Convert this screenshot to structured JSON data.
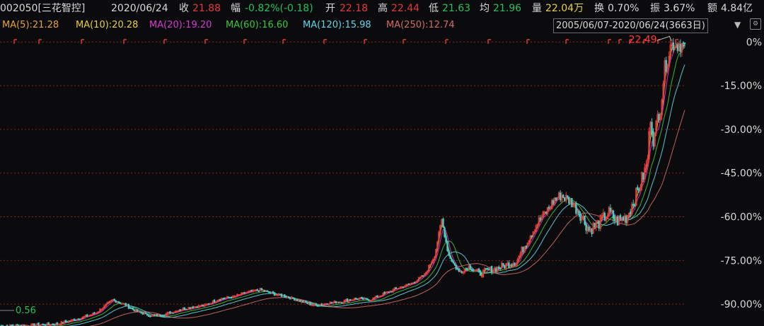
{
  "header": {
    "code_name": "002050[三花智控]",
    "date": "2020/06/24",
    "close": {
      "label": "收",
      "value": "21.88"
    },
    "change": {
      "label": "幅",
      "value": "-0.82%(-0.18)"
    },
    "open": {
      "label": "开",
      "value": "22.18"
    },
    "high": {
      "label": "高",
      "value": "22.44"
    },
    "low": {
      "label": "低",
      "value": "21.63"
    },
    "avg": {
      "label": "均",
      "value": "21.96"
    },
    "volume": {
      "label": "量",
      "value": "22.04万"
    },
    "turnover": {
      "label": "换",
      "value": "0.70%"
    },
    "amplitude": {
      "label": "振",
      "value": "3.67%"
    },
    "amount": {
      "label": "额",
      "value": "4.84亿"
    }
  },
  "ma_bar": [
    {
      "text": "MA(5):21.28",
      "color": "#e8a23a"
    },
    {
      "text": "MA(10):20.28",
      "color": "#e8d23a"
    },
    {
      "text": "MA(20):19.20",
      "color": "#d63ad6"
    },
    {
      "text": "MA(60):16.60",
      "color": "#3ac83a"
    },
    {
      "text": "MA(120):15.98",
      "color": "#5ed8e8"
    },
    {
      "text": "MA(250):12.74",
      "color": "#d06a6a"
    }
  ],
  "range_label": "2005/06/07-2020/06/24(3663日)",
  "colors": {
    "up": "#e23a3a",
    "down": "#3ad0c8",
    "grid": "#8a2020",
    "axis_text": "#d8d8d8",
    "low_label": "#22c45a",
    "high_label": "#ff3a3a"
  },
  "chart_data": {
    "type": "candlestick",
    "y_axis_ticks": [
      "0%",
      "-15.00%",
      "-30.00%",
      "-45.00%",
      "-60.00%",
      "-75.00%",
      "-90.00%"
    ],
    "y_scale": "percent below period high",
    "y_range_percent": [
      -97.5,
      3
    ],
    "x_range_days": 3663,
    "grid": true,
    "period_high": {
      "value": "22.49",
      "x_frac": 0.98
    },
    "period_low": {
      "value": "0.56",
      "x_frac": 0.0
    },
    "price_path_percent": [
      [
        0.0,
        -97.5
      ],
      [
        0.04,
        -97.2
      ],
      [
        0.08,
        -96.9
      ],
      [
        0.1,
        -95.8
      ],
      [
        0.12,
        -94.6
      ],
      [
        0.14,
        -93.0
      ],
      [
        0.155,
        -90.2
      ],
      [
        0.165,
        -88.5
      ],
      [
        0.18,
        -90.0
      ],
      [
        0.2,
        -92.5
      ],
      [
        0.22,
        -94.0
      ],
      [
        0.24,
        -93.5
      ],
      [
        0.26,
        -92.0
      ],
      [
        0.28,
        -91.0
      ],
      [
        0.3,
        -90.3
      ],
      [
        0.32,
        -88.2
      ],
      [
        0.34,
        -87.5
      ],
      [
        0.36,
        -86.0
      ],
      [
        0.38,
        -85.0
      ],
      [
        0.4,
        -86.5
      ],
      [
        0.42,
        -87.5
      ],
      [
        0.44,
        -89.0
      ],
      [
        0.46,
        -90.5
      ],
      [
        0.48,
        -89.5
      ],
      [
        0.5,
        -89.0
      ],
      [
        0.52,
        -88.0
      ],
      [
        0.54,
        -88.5
      ],
      [
        0.56,
        -86.5
      ],
      [
        0.58,
        -84.5
      ],
      [
        0.6,
        -83.0
      ],
      [
        0.62,
        -80.0
      ],
      [
        0.635,
        -73.0
      ],
      [
        0.645,
        -61.0
      ],
      [
        0.655,
        -73.0
      ],
      [
        0.67,
        -79.0
      ],
      [
        0.685,
        -77.0
      ],
      [
        0.7,
        -79.5
      ],
      [
        0.72,
        -78.0
      ],
      [
        0.74,
        -76.5
      ],
      [
        0.755,
        -75.0
      ],
      [
        0.77,
        -68.0
      ],
      [
        0.785,
        -62.0
      ],
      [
        0.8,
        -57.5
      ],
      [
        0.81,
        -54.0
      ],
      [
        0.82,
        -52.5
      ],
      [
        0.835,
        -55.0
      ],
      [
        0.85,
        -60.0
      ],
      [
        0.86,
        -64.5
      ],
      [
        0.875,
        -62.0
      ],
      [
        0.89,
        -58.5
      ],
      [
        0.9,
        -61.5
      ],
      [
        0.915,
        -60.0
      ],
      [
        0.93,
        -52.0
      ],
      [
        0.945,
        -42.0
      ],
      [
        0.95,
        -25.0
      ],
      [
        0.955,
        -35.0
      ],
      [
        0.96,
        -26.0
      ],
      [
        0.965,
        -22.0
      ],
      [
        0.97,
        -10.0
      ],
      [
        0.98,
        -0.5
      ]
    ],
    "ma_lines": [
      {
        "name": "MA(5)",
        "value": "21.28",
        "color": "#e8a23a",
        "lag": 1
      },
      {
        "name": "MA(10)",
        "value": "20.28",
        "color": "#e8d23a",
        "lag": 2
      },
      {
        "name": "MA(20)",
        "value": "19.20",
        "color": "#d63ad6",
        "lag": 4
      },
      {
        "name": "MA(60)",
        "value": "16.60",
        "color": "#3ac83a",
        "lag": 10
      },
      {
        "name": "MA(120)",
        "value": "15.98",
        "color": "#5ed8e8",
        "lag": 18
      },
      {
        "name": "MA(250)",
        "value": "12.74",
        "color": "#d06a6a",
        "lag": 34
      }
    ]
  }
}
